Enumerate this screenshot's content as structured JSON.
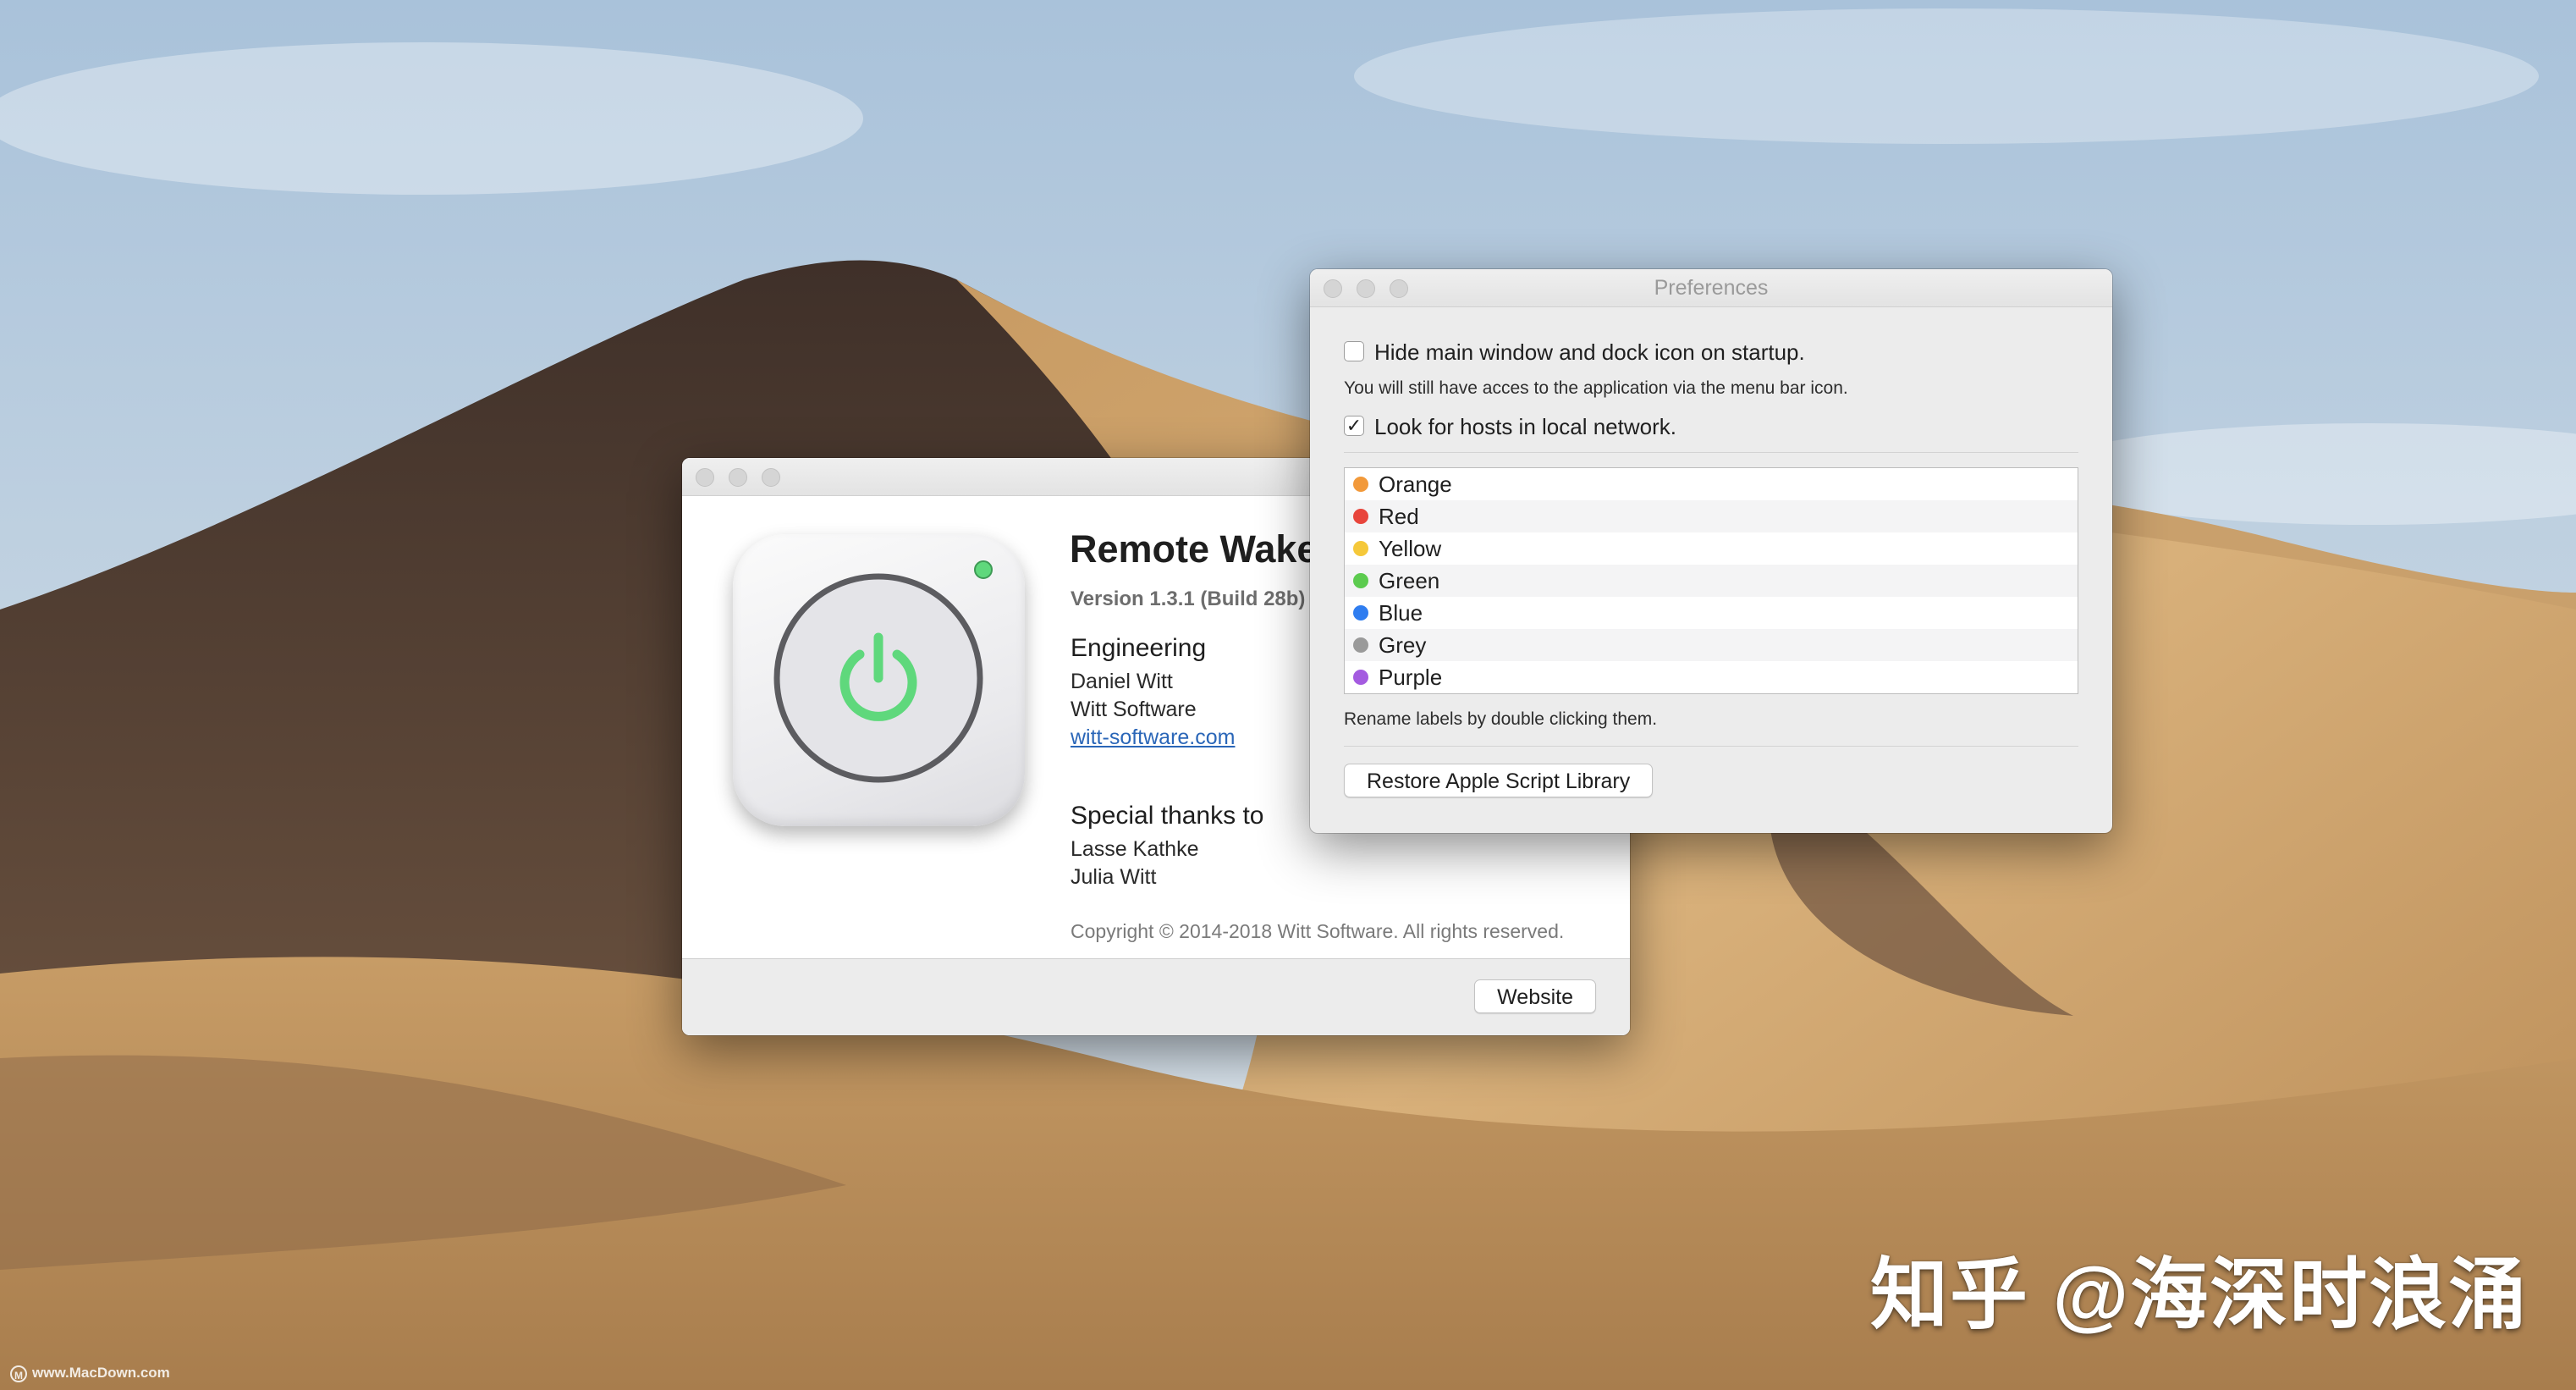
{
  "desktop": {
    "wallpaper": "Mojave desert dunes",
    "sky_color": "#b9cde0",
    "sand_light": "#d9b27a",
    "sand_dark": "#5b4638"
  },
  "about_window": {
    "app_name": "Remote Wake",
    "version": "Version 1.3.1 (Build 28b)",
    "icon": "power-icon",
    "engineering": {
      "heading": "Engineering",
      "name": "Daniel Witt",
      "company": "Witt Software",
      "website_link": "witt-software.com"
    },
    "thanks": {
      "heading": "Special thanks to",
      "people": [
        "Lasse Kathke",
        "Julia Witt"
      ]
    },
    "copyright": "Copyright © 2014-2018 Witt Software. All rights reserved.",
    "website_button": "Website",
    "accent_color": "#5fd87c"
  },
  "preferences_window": {
    "title": "Preferences",
    "hide_on_startup": {
      "label": "Hide main window and dock icon on startup.",
      "checked": false,
      "note": "You will still have acces to the application via the menu bar icon."
    },
    "look_for_hosts": {
      "label": "Look for hosts in local network.",
      "checked": true,
      "check_glyph": "✓"
    },
    "labels": [
      {
        "name": "Orange",
        "color": "#f2993a"
      },
      {
        "name": "Red",
        "color": "#e8453c"
      },
      {
        "name": "Yellow",
        "color": "#f5c83a"
      },
      {
        "name": "Green",
        "color": "#5ccb4f"
      },
      {
        "name": "Blue",
        "color": "#2f7df0"
      },
      {
        "name": "Grey",
        "color": "#9a9a9a"
      },
      {
        "name": "Purple",
        "color": "#a45be0"
      }
    ],
    "rename_hint": "Rename labels by double clicking them.",
    "restore_button": "Restore Apple Script Library"
  },
  "watermarks": {
    "zhihu": "知乎 @海深时浪涌",
    "macdown": "www.MacDown.com",
    "macdown_logo": "M"
  }
}
